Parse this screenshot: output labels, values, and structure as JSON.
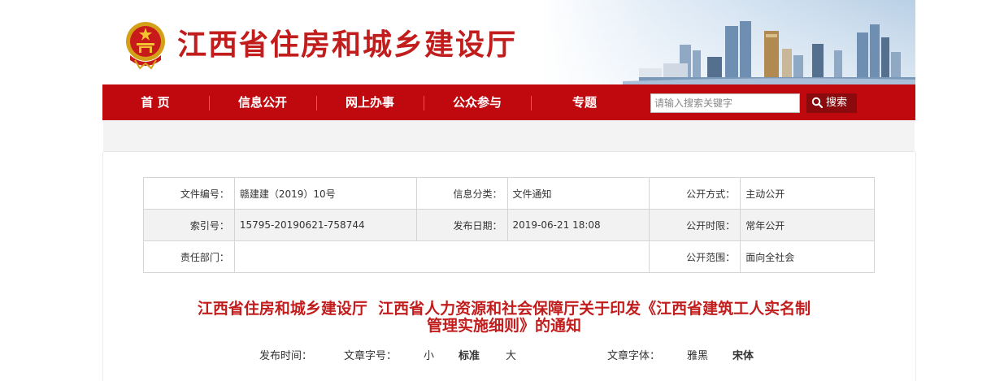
{
  "header": {
    "site_title": "江西省住房和城乡建设厅"
  },
  "nav": {
    "items": [
      {
        "label": "首 页"
      },
      {
        "label": "信息公开"
      },
      {
        "label": "网上办事"
      },
      {
        "label": "公众参与"
      },
      {
        "label": "专题"
      }
    ]
  },
  "search": {
    "placeholder": "请输入搜索关键字",
    "button_label": "搜索"
  },
  "meta": {
    "rows": [
      [
        {
          "label": "文件编号：",
          "value": "赣建建（2019）10号"
        },
        {
          "label": "信息分类：",
          "value": "文件通知"
        },
        {
          "label": "公开方式：",
          "value": "主动公开"
        }
      ],
      [
        {
          "label": "索引号：",
          "value": "15795-20190621-758744"
        },
        {
          "label": "发布日期：",
          "value": "2019-06-21 18:08"
        },
        {
          "label": "公开时限：",
          "value": "常年公开"
        }
      ],
      [
        {
          "label": "责任部门：",
          "value": ""
        },
        {
          "label": "公开范围：",
          "value": "面向全社会"
        }
      ]
    ]
  },
  "article": {
    "title_line1": "江西省住房和城乡建设厅  江西省人力资源和社会保障厅关于印发《江西省建筑工人实名制",
    "title_line2": "管理实施细则》的通知"
  },
  "pubbar": {
    "publish_time_label": "发布时间：",
    "font_size_label": "文章字号：",
    "size_small": "小",
    "size_standard": "标准",
    "size_large": "大",
    "font_family_label": "文章字体：",
    "font_yahei": "雅黑",
    "font_song": "宋体"
  },
  "colors": {
    "brand_red": "#c0090f",
    "title_red": "#c21d1d",
    "search_button": "#8a0a0e"
  }
}
